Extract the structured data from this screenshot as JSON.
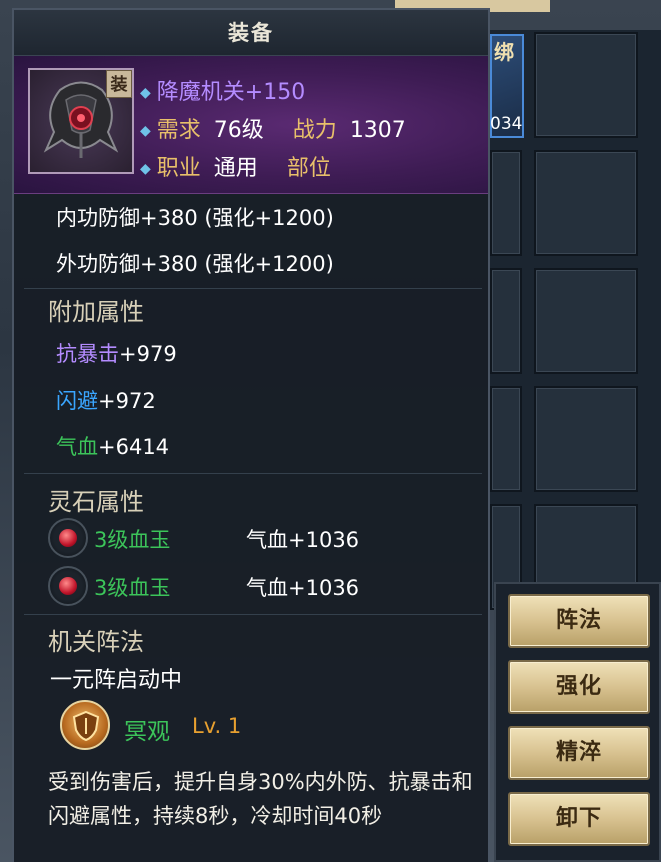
{
  "panel": {
    "title": "装备"
  },
  "item": {
    "badge": "装",
    "name": "降魔机关+150",
    "req_label": "需求",
    "req_value": "76级",
    "power_label": "战力",
    "power_value": "1307",
    "job_label": "职业",
    "job_value": "通用",
    "slot_label": "部位"
  },
  "base_stats": [
    "内功防御+380 (强化+1200)",
    "外功防御+380 (强化+1200)"
  ],
  "extra": {
    "title": "附加属性",
    "stats": [
      {
        "name": "抗暴击",
        "value": "+979",
        "color": "#b48cff"
      },
      {
        "name": "闪避",
        "value": "+972",
        "color": "#3aa6ff"
      },
      {
        "name": "气血",
        "value": "+6414",
        "color": "#3cc45a"
      }
    ]
  },
  "gems": {
    "title": "灵石属性",
    "items": [
      {
        "icon": "blood-jade-gem-icon",
        "name": "3级血玉",
        "effect": "气血+1036"
      },
      {
        "icon": "blood-jade-gem-icon",
        "name": "3级血玉",
        "effect": "气血+1036"
      }
    ]
  },
  "formation": {
    "title": "机关阵法",
    "status": "一元阵启动中",
    "skill_icon": "shield-skill-icon",
    "skill_name": "冥观",
    "skill_level": "Lv. 1",
    "description": "受到伤害后，提升自身30%内外防、抗暴击和闪避属性，持续8秒，冷却时间40秒"
  },
  "inventory": {
    "bind_label": "绑",
    "count": "034"
  },
  "actions": {
    "formation": "阵法",
    "enhance": "强化",
    "refine": "精淬",
    "unequip": "卸下"
  }
}
